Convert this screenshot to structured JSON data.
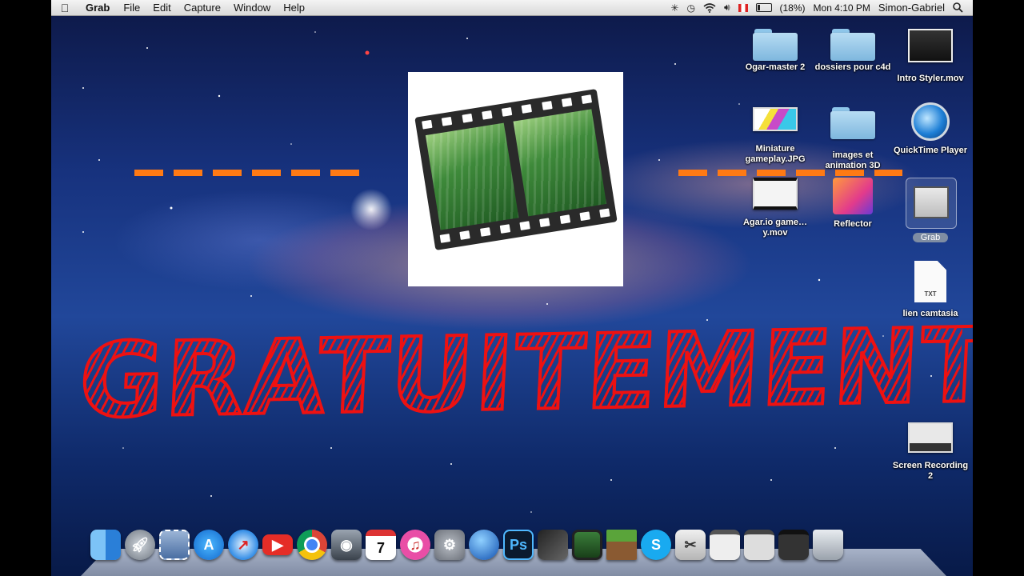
{
  "menubar": {
    "apple": "",
    "app_name": "Grab",
    "menus": [
      "File",
      "Edit",
      "Capture",
      "Window",
      "Help"
    ],
    "battery": "(18%)",
    "clock": "Mon 4:10 PM",
    "user": "Simon-Gabriel",
    "status_icons": [
      "bluetooth-icon",
      "time-machine-icon",
      "wifi-icon",
      "volume-icon",
      "keyboard-flag-icon",
      "battery-icon",
      "spotlight-icon"
    ]
  },
  "overlay": {
    "headline": "GRATUITEMENT",
    "headline_color": "#ee1111",
    "dash_color": "#ff7a14"
  },
  "desktop_icons": [
    {
      "label": "Ogar-master 2",
      "icon": "folder-icon"
    },
    {
      "label": "dossiers pour c4d",
      "icon": "folder-icon"
    },
    {
      "label": "Intro Styler.mov",
      "icon": "movie-file-icon"
    },
    {
      "label": "Miniature gameplay.JPG",
      "icon": "image-file-icon"
    },
    {
      "label": "images et animation 3D",
      "icon": "folder-icon"
    },
    {
      "label": "QuickTime Player",
      "icon": "quicktime-icon"
    },
    {
      "label": "Agar.io game…y.mov",
      "icon": "movie-file-icon"
    },
    {
      "label": "Reflector",
      "icon": "reflector-icon"
    },
    {
      "label": "Grab",
      "icon": "grab-icon"
    },
    {
      "label": "lien camtasia",
      "icon": "txt-file-icon",
      "badge": "TXT"
    },
    {
      "label": "Screen Recording 2",
      "icon": "movie-file-icon"
    }
  ],
  "dock": {
    "calendar_day": "7",
    "photoshop_label": "Ps",
    "apps": [
      "finder",
      "launchpad",
      "mail",
      "app-store",
      "safari",
      "youtube",
      "chrome",
      "facetime",
      "calendar",
      "itunes",
      "system-preferences",
      "network",
      "photoshop",
      "final-cut",
      "imovie",
      "minecraft",
      "skype",
      "grab",
      "window-1",
      "window-2",
      "window-3",
      "trash"
    ]
  }
}
